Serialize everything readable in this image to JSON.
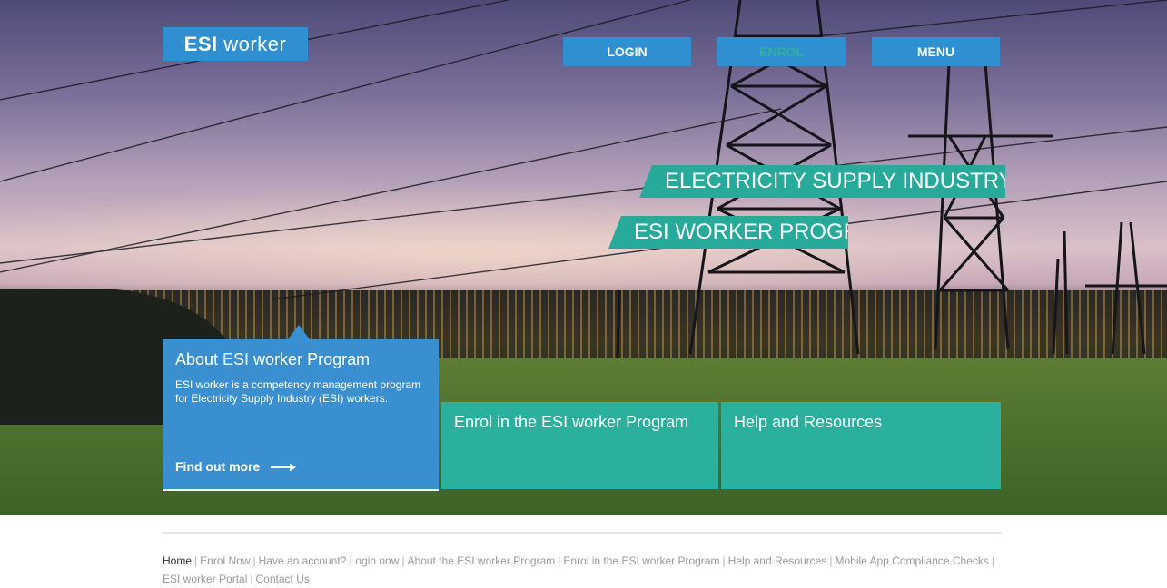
{
  "header": {
    "logo_bold": "ESI",
    "logo_text": "worker",
    "nav": {
      "login": "LOGIN",
      "enrol": "ENROL",
      "menu": "MENU"
    }
  },
  "hero": {
    "banner_industry": "ELECTRICITY SUPPLY INDUSTRY (ESI)",
    "banner_program": "ESI WORKER PROGRAM"
  },
  "cards": {
    "about": {
      "title": "About ESI worker Program",
      "description": "ESI worker is a competency management program for Electricity Supply Industry (ESI) workers.",
      "link": "Find out more",
      "link_icon": "arrow-right-icon"
    },
    "enrol": {
      "title": "Enrol in the ESI worker Program"
    },
    "help": {
      "title": "Help and Resources"
    }
  },
  "footer": {
    "links": [
      "Home",
      "Enrol Now",
      "Have an account? Login now",
      "About the ESI worker Program",
      "Enrol in the ESI worker Program",
      "Help and Resources",
      "Mobile App Compliance Checks",
      "ESI worker Portal",
      "Contact Us"
    ]
  },
  "colors": {
    "brand_blue": "#2f8fd0",
    "teal": "#2ab09c",
    "banner_teal": "#27aa9a"
  }
}
